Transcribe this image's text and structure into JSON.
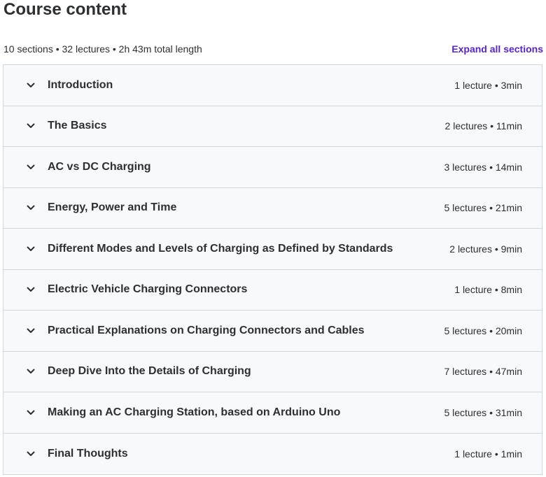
{
  "header": {
    "title": "Course content",
    "summary": "10 sections • 32 lectures • 2h 43m total length",
    "expand_label": "Expand all sections"
  },
  "colors": {
    "accent": "#5624d0",
    "text": "#2d2f31",
    "section_bg": "#f7f9fa",
    "border": "#d1d7dc"
  },
  "sections": [
    {
      "title": "Introduction",
      "meta": "1 lecture • 3min",
      "icon": "chevron-down-icon"
    },
    {
      "title": "The Basics",
      "meta": "2 lectures • 11min",
      "icon": "chevron-down-icon"
    },
    {
      "title": "AC vs DC Charging",
      "meta": "3 lectures • 14min",
      "icon": "chevron-down-icon"
    },
    {
      "title": "Energy, Power and Time",
      "meta": "5 lectures • 21min",
      "icon": "chevron-down-icon"
    },
    {
      "title": "Different Modes and Levels of Charging as Defined by Standards",
      "meta": "2 lectures • 9min",
      "icon": "chevron-down-icon"
    },
    {
      "title": "Electric Vehicle Charging Connectors",
      "meta": "1 lecture • 8min",
      "icon": "chevron-down-icon"
    },
    {
      "title": "Practical Explanations on Charging Connectors and Cables",
      "meta": "5 lectures • 20min",
      "icon": "chevron-down-icon"
    },
    {
      "title": "Deep Dive Into the Details of Charging",
      "meta": "7 lectures • 47min",
      "icon": "chevron-down-icon"
    },
    {
      "title": "Making an AC Charging Station, based on Arduino Uno",
      "meta": "5 lectures • 31min",
      "icon": "chevron-down-icon"
    },
    {
      "title": "Final Thoughts",
      "meta": "1 lecture • 1min",
      "icon": "chevron-down-icon"
    }
  ]
}
